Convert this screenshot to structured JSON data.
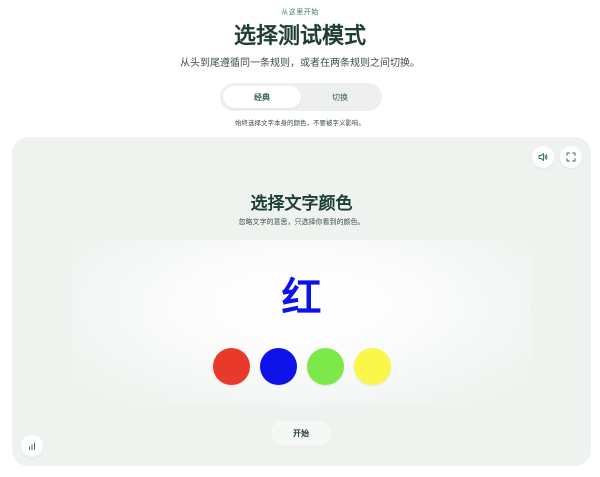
{
  "header": {
    "eyebrow": "从这里开始",
    "title": "选择测试模式",
    "subtitle": "从头到尾遵循同一条规则，或者在两条规则之间切换。"
  },
  "mode_switch": {
    "tabs": [
      {
        "label": "经典",
        "active": true
      },
      {
        "label": "切换",
        "active": false
      }
    ],
    "hint": "始终选择文字本身的颜色，不要被字义影响。"
  },
  "game": {
    "title": "选择文字颜色",
    "instruction": "忽略文字的意思，只选择你看到的颜色。",
    "stimulus": {
      "word": "红",
      "ink_color": "#0d12e8"
    },
    "options": [
      {
        "name": "red",
        "color": "#e8392a"
      },
      {
        "name": "blue",
        "color": "#0d12e8"
      },
      {
        "name": "green",
        "color": "#7de84a"
      },
      {
        "name": "yellow",
        "color": "#fbf64a"
      }
    ],
    "start_label": "开始",
    "icons": {
      "sound": "volume-icon",
      "fullscreen": "fullscreen-icon",
      "stats": "bar-chart-icon"
    }
  },
  "theme": {
    "accent": "#2c6b57",
    "card_bg": "#eef3ef",
    "title_color": "#1e3d36"
  }
}
